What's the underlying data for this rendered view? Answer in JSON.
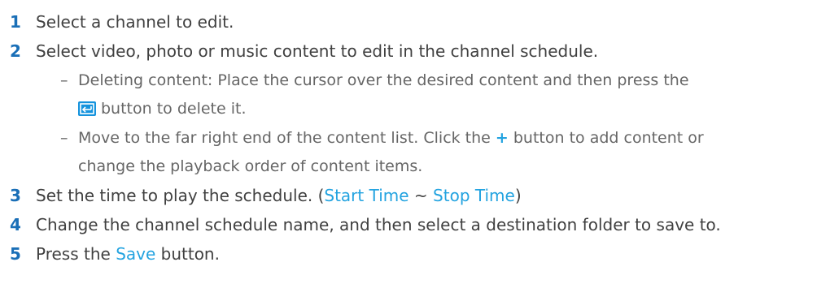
{
  "steps": [
    {
      "num": "1",
      "text": "Select a channel to edit."
    },
    {
      "num": "2",
      "text": "Select video, photo or music content to edit in the channel schedule."
    },
    {
      "num": "3",
      "text_before": "Set the time to play the schedule. (",
      "start_label": "Start Time",
      "sep": " ~ ",
      "stop_label": "Stop Time",
      "text_after": ")"
    },
    {
      "num": "4",
      "text": "Change the channel schedule name, and then select a destination folder to save to."
    },
    {
      "num": "5",
      "text_before": "Press the ",
      "save_label": "Save",
      "text_after": " button."
    }
  ],
  "substeps": {
    "delete_line1": "Deleting content: Place the cursor over the desired content and then press the",
    "delete_line2": "button to delete it.",
    "move_line1_before": "Move to the far right end of the content list. Click the ",
    "plus": "+",
    "move_line1_after": " button to add content or",
    "move_line2": "change the playback order of content items.",
    "dash": "–"
  },
  "colors": {
    "step_number": "#1a6fb7",
    "highlight": "#23a3e0",
    "icon_bg": "#1593dd"
  },
  "icons": {
    "delete_button": "enter-return-icon"
  }
}
